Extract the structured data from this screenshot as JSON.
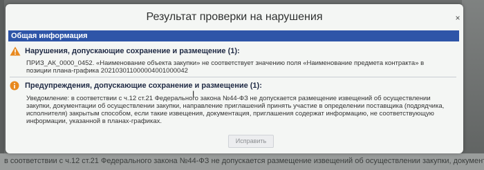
{
  "dialog": {
    "title": "Результат проверки на нарушения",
    "close_symbol": "×",
    "section_header": "Общая информация",
    "errors": {
      "header": "Нарушения, допускающие сохранение и размещение (1):",
      "icon": "warning-triangle-icon",
      "icon_color": "#e8891f",
      "message": "ПРИЗ_АК_0000_0452. «Наименование объекта закупки» не соответствует значению поля «Наименование предмета контракта» в позиции плана-графика 202103011000004001000042"
    },
    "warnings": {
      "header": "Предупреждения, допускающие сохранение и размещение (1):",
      "icon": "info-circle-icon",
      "icon_color": "#e8891f",
      "message": "Уведомление: в соответствии с ч.12 ст.21 Федерального закона №44-ФЗ не допускается размещение извещений об осуществлении закупки, документации об осуществлении закупки, направление приглашений принять участие в определении поставщика (подрядчика, исполнителя) закрытым способом, если такие извещения, документация, приглашения содержат информацию, не соответствующую информации, указанной в планах-графиках."
    },
    "fix_button": "Исправить"
  },
  "background": {
    "text": "в соответствии с ч.12 ст.21 Федерального закона №44-ФЗ не допускается размещение извещений об осуществлении закупки, документации об осуществлении"
  },
  "colors": {
    "header_bar": "#2e55a8",
    "dialog_bg": "#f4f6f4"
  }
}
